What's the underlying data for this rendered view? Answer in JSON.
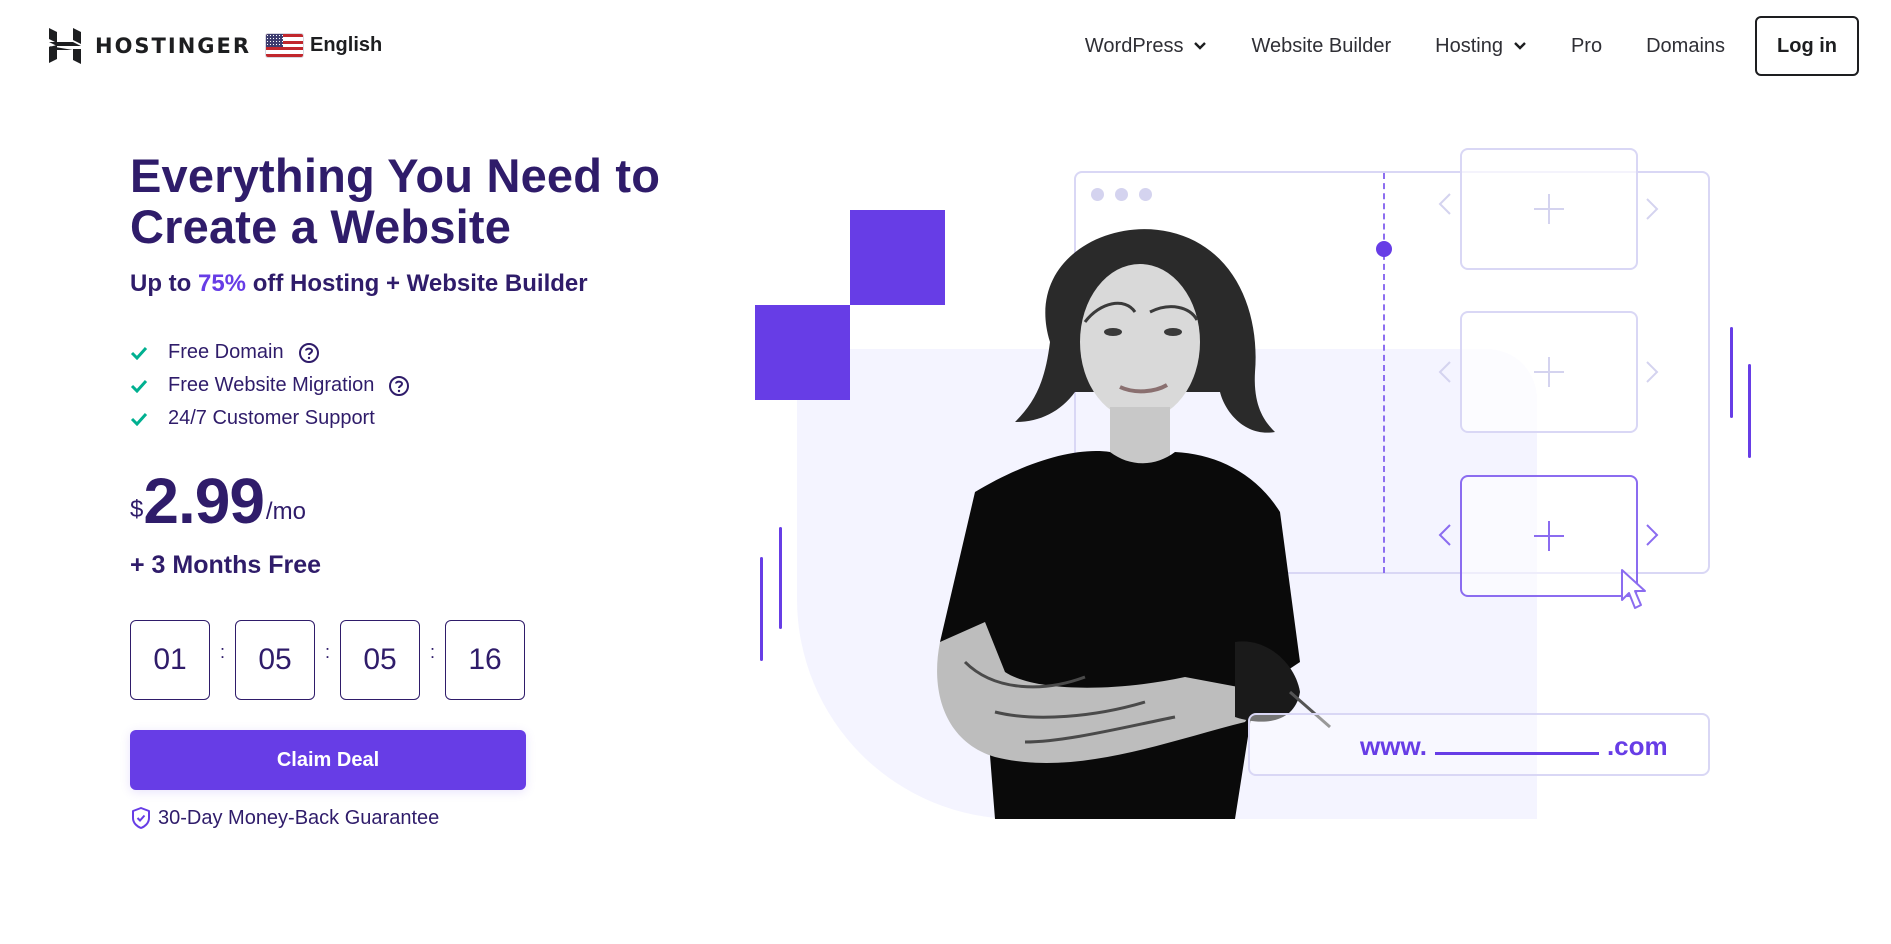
{
  "header": {
    "brand": "HOSTINGER",
    "language": {
      "label": "English",
      "flag": "us-flag-icon"
    },
    "nav": [
      {
        "label": "WordPress",
        "has_dropdown": true
      },
      {
        "label": "Website Builder",
        "has_dropdown": false
      },
      {
        "label": "Hosting",
        "has_dropdown": true
      },
      {
        "label": "Pro",
        "has_dropdown": false
      },
      {
        "label": "Domains",
        "has_dropdown": false
      }
    ],
    "login_label": "Log in"
  },
  "hero": {
    "headline_line1": "Everything You Need to",
    "headline_line2": "Create a Website",
    "sub_prefix": "Up to ",
    "sub_accent": "75%",
    "sub_suffix": " off Hosting + Website Builder",
    "features": [
      {
        "label": "Free Domain",
        "has_help": true
      },
      {
        "label": "Free Website Migration",
        "has_help": true
      },
      {
        "label": "24/7 Customer Support",
        "has_help": false
      }
    ],
    "price": {
      "currency": "$",
      "amount": "2.99",
      "period": "/mo"
    },
    "bonus": "+ 3 Months Free",
    "countdown": {
      "days": "01",
      "hours": "05",
      "minutes": "05",
      "seconds": "16",
      "separator": ":"
    },
    "cta_label": "Claim Deal",
    "guarantee": "30-Day Money-Back Guarantee"
  },
  "illustration": {
    "url_prefix": "www.",
    "url_suffix": ".com",
    "alt": "Woman with tattooed arms standing with crossed arms in front of website builder wireframe"
  },
  "colors": {
    "accent": "#673de6",
    "title": "#2f1c6a",
    "check": "#00b090",
    "panel": "#f4f4ff"
  }
}
